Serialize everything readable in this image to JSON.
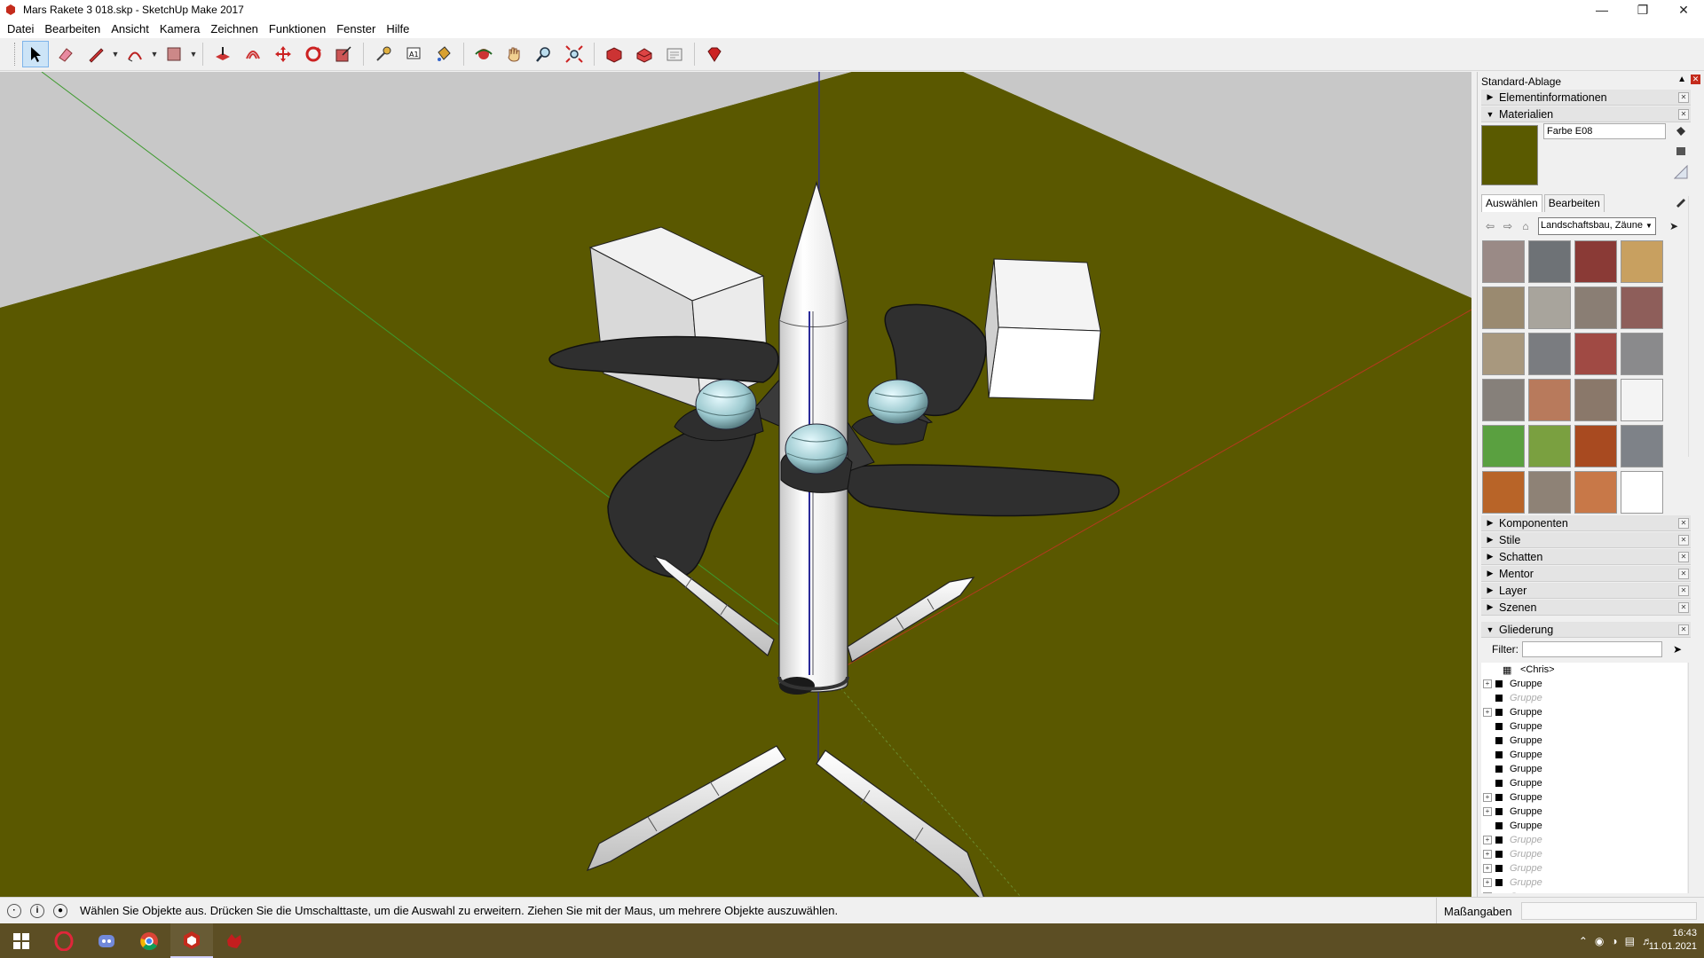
{
  "window": {
    "title": "Mars Rakete 3 018.skp - SketchUp Make 2017"
  },
  "menu": [
    "Datei",
    "Bearbeiten",
    "Ansicht",
    "Kamera",
    "Zeichnen",
    "Funktionen",
    "Fenster",
    "Hilfe"
  ],
  "toolbar": {
    "tools": [
      "select-tool",
      "eraser-tool",
      "line-tool",
      "arc-tool",
      "rectangle-tool",
      "push-pull-tool",
      "offset-tool",
      "move-tool",
      "rotate-tool",
      "scale-tool",
      "tape-measure-tool",
      "text-tool",
      "paint-bucket-tool",
      "orbit-tool",
      "pan-tool",
      "zoom-tool",
      "zoom-extents-tool",
      "3d-warehouse-tool",
      "extension-warehouse-tool",
      "layout-tool",
      "ruby-tool"
    ]
  },
  "tray": {
    "title": "Standard-Ablage",
    "entity_info": "Elementinformationen",
    "materials": {
      "title": "Materialien",
      "name": "Farbe E08",
      "color": "#5a5a00",
      "tab_select": "Auswählen",
      "tab_edit": "Bearbeiten",
      "library": "Landschaftsbau, Zäune",
      "swatches": [
        "#9a8a86",
        "#6e7276",
        "#8a3a36",
        "#c8a060",
        "#9a8a70",
        "#a8a49c",
        "#8a7e74",
        "#8e5e5a",
        "#a8987e",
        "#7a7c80",
        "#a04a44",
        "#8a8a8c",
        "#86807a",
        "#b87a5c",
        "#8a786a",
        "#f4f4f4",
        "#5aa040",
        "#7aa040",
        "#a84a20",
        "#7e8288",
        "#b86428",
        "#8e8276",
        "#c87848",
        "#ffffff"
      ]
    },
    "panels": [
      "Komponenten",
      "Stile",
      "Schatten",
      "Mentor",
      "Layer",
      "Szenen"
    ],
    "outliner": {
      "title": "Gliederung",
      "filter_label": "Filter:",
      "root": "<Chris>",
      "items": [
        {
          "label": "Gruppe",
          "expandable": true,
          "hidden": false
        },
        {
          "label": "Gruppe",
          "expandable": false,
          "hidden": true
        },
        {
          "label": "Gruppe",
          "expandable": true,
          "hidden": false
        },
        {
          "label": "Gruppe",
          "expandable": false,
          "hidden": false
        },
        {
          "label": "Gruppe",
          "expandable": false,
          "hidden": false
        },
        {
          "label": "Gruppe",
          "expandable": false,
          "hidden": false
        },
        {
          "label": "Gruppe",
          "expandable": false,
          "hidden": false
        },
        {
          "label": "Gruppe",
          "expandable": false,
          "hidden": false
        },
        {
          "label": "Gruppe",
          "expandable": true,
          "hidden": false
        },
        {
          "label": "Gruppe",
          "expandable": true,
          "hidden": false
        },
        {
          "label": "Gruppe",
          "expandable": false,
          "hidden": false
        },
        {
          "label": "Gruppe",
          "expandable": true,
          "hidden": true
        },
        {
          "label": "Gruppe",
          "expandable": true,
          "hidden": true
        },
        {
          "label": "Gruppe",
          "expandable": true,
          "hidden": true
        },
        {
          "label": "Gruppe",
          "expandable": true,
          "hidden": true
        },
        {
          "label": "Gruppe",
          "expandable": true,
          "hidden": true
        }
      ]
    }
  },
  "status": {
    "message": "Wählen Sie Objekte aus. Drücken Sie die Umschalttaste, um die Auswahl zu erweitern. Ziehen Sie mit der Maus, um mehrere Objekte auszuwählen.",
    "measure_label": "Maßangaben"
  },
  "taskbar": {
    "apps": [
      "windows-start",
      "opera",
      "discord",
      "chrome",
      "sketchup",
      "red-app"
    ],
    "time": "16:43",
    "date": "11.01.2021"
  },
  "colors": {
    "ground": "#5a5800",
    "sky": "#c8c8c8",
    "accent": "#c42b1c"
  }
}
